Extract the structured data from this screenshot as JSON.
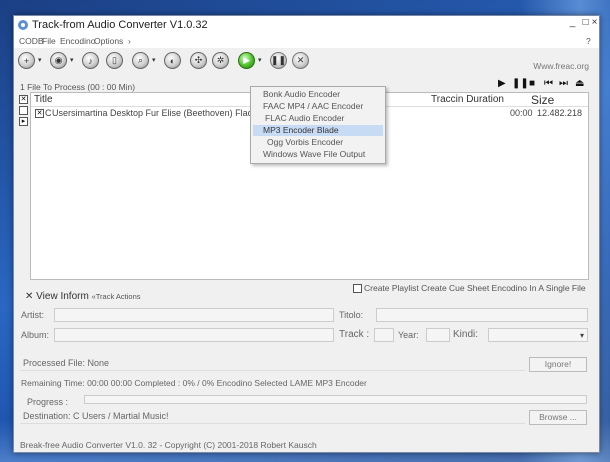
{
  "window": {
    "title": "Track-from Audio Converter V1.0.32",
    "minimize": "_",
    "maximize": "□",
    "close": "×",
    "menu": [
      "CODB",
      "File",
      "Encodino",
      "Options",
      "›"
    ],
    "help": "?"
  },
  "toolbar": {
    "link": "Www.freac.org"
  },
  "files": {
    "count_label": "1 File To Process (00 : 00 Min)",
    "columns": {
      "title": "Title",
      "track_duration": "Traccin Duration",
      "size": "Size"
    },
    "rows": [
      {
        "title": "Usersimartina Desktop Fur Elise (Beethoven) Flac",
        "time": "00:00",
        "size": "12.482.218"
      }
    ]
  },
  "encoders_menu": {
    "items": [
      "Bonk Audio Encoder",
      "FAAC MP4 / AAC Encoder",
      "FLAC Audio Encoder",
      "MP3 Encoder Blade",
      "Ogg Vorbis Encoder",
      "Windows Wave File Output"
    ],
    "selected_index": 3
  },
  "playlist": {
    "label": "Create Playlist Create Cue Sheet Encodino In A Single File"
  },
  "tabs": {
    "view": "View",
    "inform": "Inform",
    "track_actions": "«Track Actions"
  },
  "tags": {
    "artist_label": "Artist:",
    "title_label": "Titolo:",
    "album_label": "Album:",
    "track_label": "Track :",
    "year_label": "Year:",
    "kind_label": "Kindi:"
  },
  "progress": {
    "processed_file_label": "Processed File: None",
    "ignore_button": "Ignore!",
    "remaining_line": "Remaining Time: 00:00 00:00 Completed : 0% / 0% Encodino Selected LAME MP3 Encoder",
    "progress_label": "Progress :"
  },
  "destination": {
    "label": "Destination: C Users / Martial Music!",
    "browse_button": "Browse ..."
  },
  "statusbar": {
    "text": "Break-free Audio Converter V1.0. 32 - Copyright (C) 2001-2018 Robert Kausch"
  }
}
